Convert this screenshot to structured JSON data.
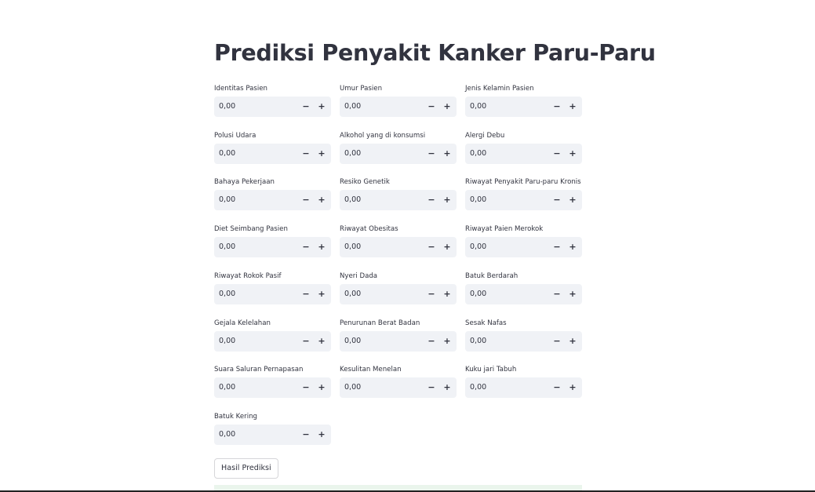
{
  "title": "Prediksi Penyakit Kanker Paru-Paru",
  "fields": [
    {
      "label": "Identitas Pasien",
      "value": "0,00"
    },
    {
      "label": "Umur Pasien",
      "value": "0,00"
    },
    {
      "label": "Jenis Kelamin Pasien",
      "value": "0,00"
    },
    {
      "label": "Polusi Udara",
      "value": "0,00"
    },
    {
      "label": "Alkohol yang di konsumsi",
      "value": "0,00"
    },
    {
      "label": "Alergi Debu",
      "value": "0,00"
    },
    {
      "label": "Bahaya Pekerjaan",
      "value": "0,00"
    },
    {
      "label": "Resiko Genetik",
      "value": "0,00"
    },
    {
      "label": "Riwayat Penyakit Paru-paru Kronis",
      "value": "0,00"
    },
    {
      "label": "Diet Seimbang Pasien",
      "value": "0,00"
    },
    {
      "label": "Riwayat Obesitas",
      "value": "0,00"
    },
    {
      "label": "Riwayat Paien Merokok",
      "value": "0,00"
    },
    {
      "label": "Riwayat Rokok Pasif",
      "value": "0,00"
    },
    {
      "label": "Nyeri Dada",
      "value": "0,00"
    },
    {
      "label": "Batuk Berdarah",
      "value": "0,00"
    },
    {
      "label": "Gejala Kelelahan",
      "value": "0,00"
    },
    {
      "label": "Penurunan Berat Badan",
      "value": "0,00"
    },
    {
      "label": "Sesak Nafas",
      "value": "0,00"
    },
    {
      "label": "Suara Saluran Pernapasan",
      "value": "0,00"
    },
    {
      "label": "Kesulitan Menelan",
      "value": "0,00"
    },
    {
      "label": "Kuku jari Tabuh",
      "value": "0,00"
    },
    {
      "label": "Batuk Kering",
      "value": "0,00"
    }
  ],
  "stepper": {
    "minus": "−",
    "plus": "+"
  },
  "submit_label": "Hasil Prediksi",
  "colors": {
    "text": "#31333f",
    "input_bg": "#f0f2f6",
    "result_bg": "#eaf5ec"
  }
}
